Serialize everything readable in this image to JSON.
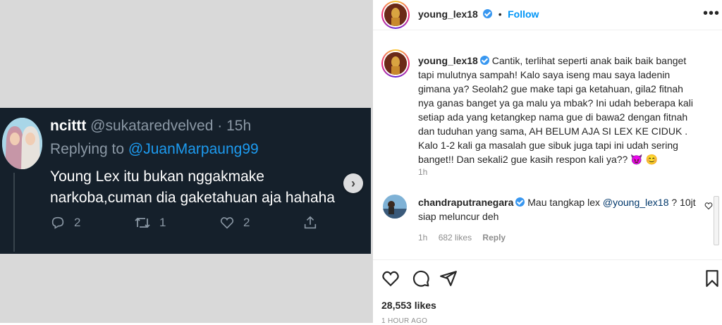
{
  "tweet": {
    "name": "ncittt",
    "handle": "@sukataredvelved",
    "time": "15h",
    "replying_prefix": "Replying to",
    "replying_to": "@JuanMarpaung99",
    "text": "Young Lex itu bukan nggakmake narkoba,cuman dia gaketahuan aja hahaha",
    "reply_count": "2",
    "retweet_count": "1",
    "like_count": "2"
  },
  "post": {
    "username": "young_lex18",
    "follow_label": "Follow",
    "caption": "Cantik, terlihat seperti anak baik baik banget tapi mulutnya sampah! Kalo saya iseng mau saya ladenin gimana ya? Seolah2 gue make tapi ga ketahuan, gila2 fitnah nya ganas banget ya ga malu ya mbak? Ini udah beberapa kali setiap ada yang ketangkep nama gue di bawa2 dengan fitnah dan tuduhan yang sama, AH BELUM AJA SI LEX KE CIDUK . Kalo 1-2 kali ga masalah gue sibuk juga tapi ini udah sering banget!! Dan sekali2 gue kasih respon kali ya?? 😈 😊",
    "caption_time": "1h",
    "likes": "28,553 likes",
    "time_ago": "1 HOUR AGO"
  },
  "comment": {
    "username": "chandraputranegara",
    "text_before": "Mau tangkap lex ",
    "mention": "@young_lex18",
    "text_after": " ? 10jt siap meluncur deh",
    "time": "1h",
    "likes": "682 likes",
    "reply_label": "Reply"
  },
  "colors": {
    "twitter_bg": "#15202b",
    "twitter_link": "#1d9bf0",
    "ig_link": "#0095f6",
    "ig_mention": "#00376b"
  }
}
